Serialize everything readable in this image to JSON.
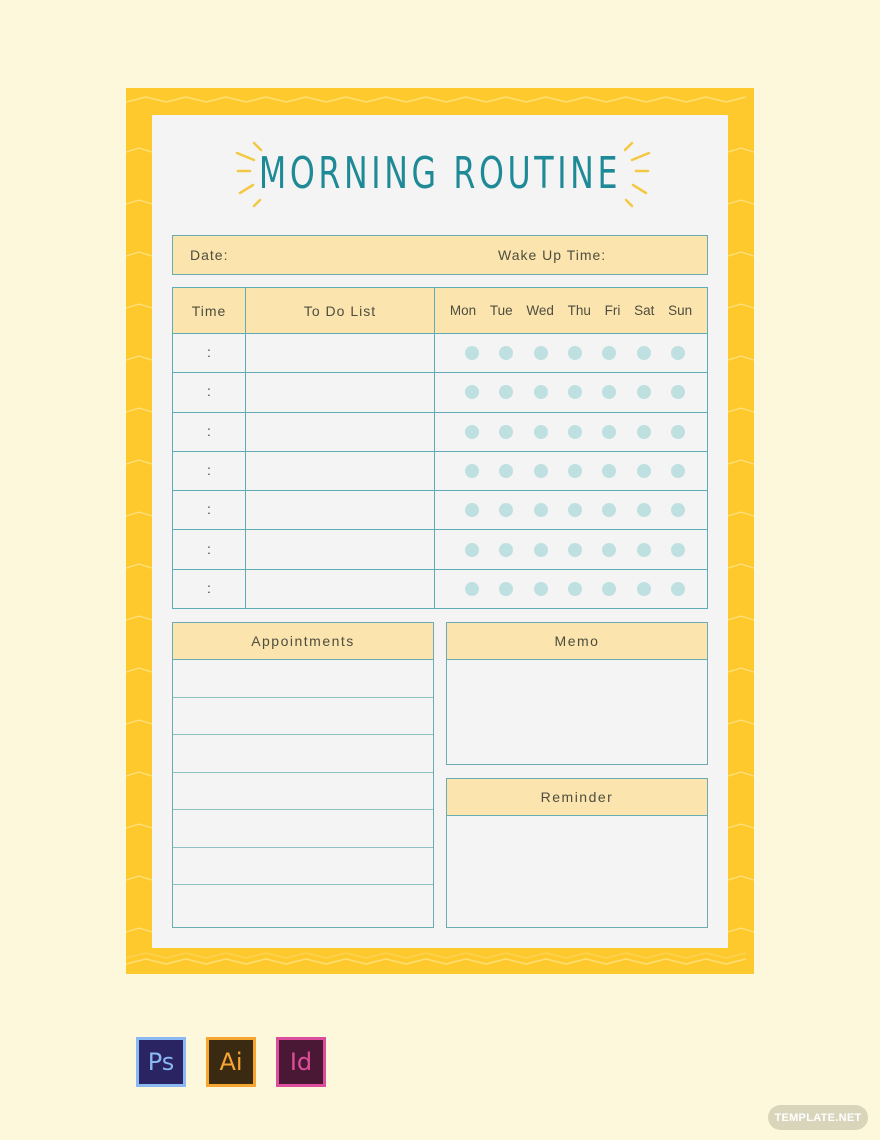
{
  "document": {
    "title": "MORNING ROUTINE",
    "date_label": "Date:",
    "wake_label": "Wake Up Time:"
  },
  "routine_table": {
    "headers": {
      "time": "Time",
      "todo": "To Do List"
    },
    "days": [
      "Mon",
      "Tue",
      "Wed",
      "Thu",
      "Fri",
      "Sat",
      "Sun"
    ],
    "rows": [
      {
        "time": ":",
        "todo": ""
      },
      {
        "time": ":",
        "todo": ""
      },
      {
        "time": ":",
        "todo": ""
      },
      {
        "time": ":",
        "todo": ""
      },
      {
        "time": ":",
        "todo": ""
      },
      {
        "time": ":",
        "todo": ""
      },
      {
        "time": ":",
        "todo": ""
      }
    ]
  },
  "appointments": {
    "title": "Appointments",
    "line_count": 7
  },
  "memo": {
    "title": "Memo"
  },
  "reminder": {
    "title": "Reminder"
  },
  "app_icons": [
    {
      "name": "photoshop-icon",
      "label": "Ps"
    },
    {
      "name": "illustrator-icon",
      "label": "Ai"
    },
    {
      "name": "indesign-icon",
      "label": "Id"
    }
  ],
  "watermark": "TEMPLATE.NET",
  "colors": {
    "frame": "#fdc92d",
    "panel": "#f4f4f4",
    "header_fill": "#fbe4ae",
    "border": "#6aacb2",
    "title": "#1f8a97",
    "dot": "#bfe0e0",
    "page_bg": "#fdf8dc"
  }
}
